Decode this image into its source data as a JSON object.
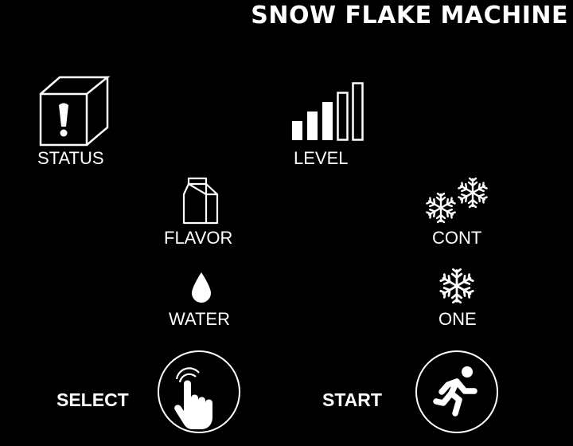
{
  "header": {
    "title": "SNOW FLAKE MACHINE"
  },
  "tiles": {
    "status": {
      "label": "STATUS",
      "icon": "status-cube-icon"
    },
    "level": {
      "label": "LEVEL",
      "icon": "level-bars-icon"
    },
    "flavor": {
      "label": "FLAVOR",
      "icon": "milk-carton-icon"
    },
    "cont": {
      "label": "CONT",
      "icon": "double-snowflake-icon"
    },
    "water": {
      "label": "WATER",
      "icon": "water-drop-icon"
    },
    "one": {
      "label": "ONE",
      "icon": "snowflake-icon"
    }
  },
  "actions": {
    "select": {
      "label": "SELECT",
      "icon": "tap-hand-icon"
    },
    "start": {
      "label": "START",
      "icon": "running-person-icon"
    }
  },
  "colors": {
    "background": "#000000",
    "foreground": "#ffffff"
  }
}
